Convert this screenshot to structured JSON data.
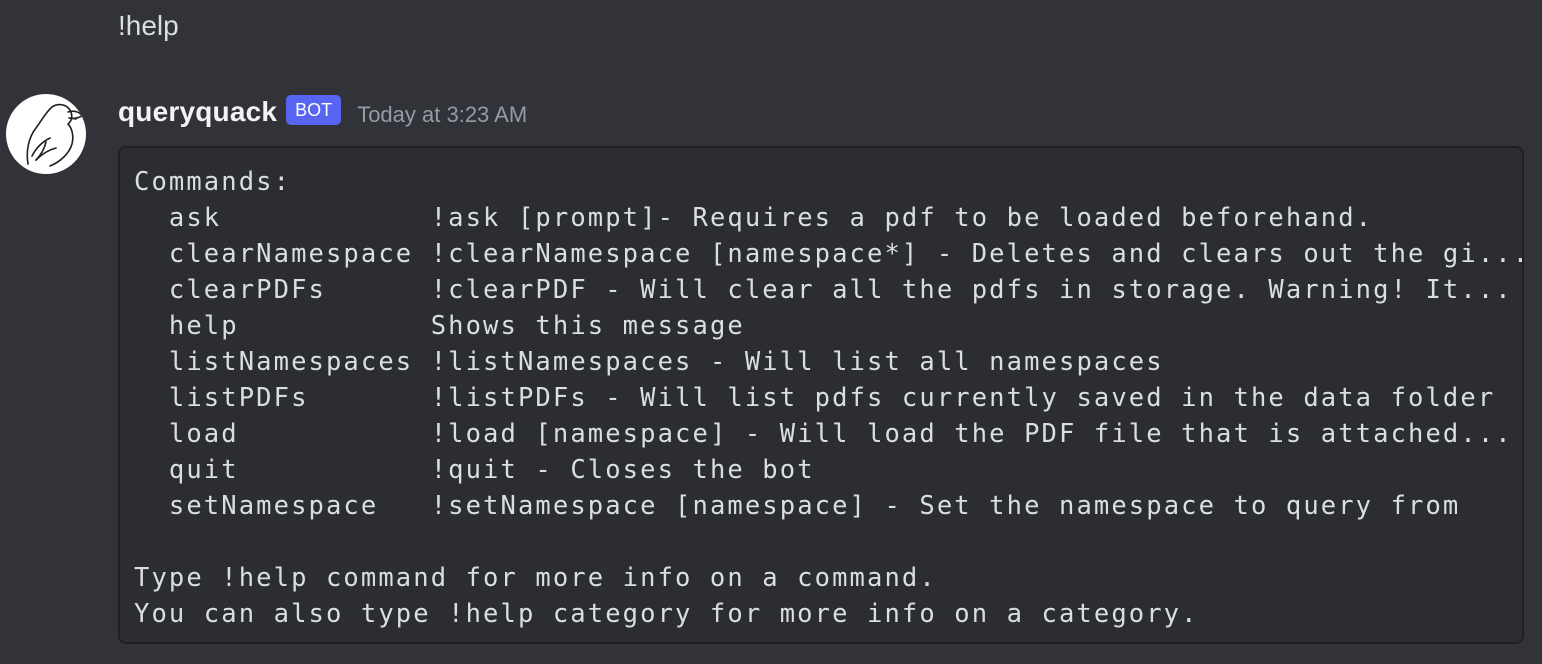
{
  "previous_message": {
    "text": "!help"
  },
  "message": {
    "username": "queryquack",
    "bot_tag": "BOT",
    "timestamp": "Today at 3:23 AM",
    "avatar": {
      "icon": "duck-line-art-icon",
      "background": "#ffffff"
    },
    "code": {
      "heading": "Commands:",
      "commands": [
        {
          "name": "ask",
          "description": "!ask [prompt]- Requires a pdf to be loaded beforehand."
        },
        {
          "name": "clearNamespace",
          "description": "!clearNamespace [namespace*] - Deletes and clears out the gi..."
        },
        {
          "name": "clearPDFs",
          "description": "!clearPDF - Will clear all the pdfs in storage. Warning! It..."
        },
        {
          "name": "help",
          "description": "Shows this message"
        },
        {
          "name": "listNamespaces",
          "description": "!listNamespaces - Will list all namespaces"
        },
        {
          "name": "listPDFs",
          "description": "!listPDFs - Will list pdfs currently saved in the data folder"
        },
        {
          "name": "load",
          "description": "!load [namespace] - Will load the PDF file that is attached..."
        },
        {
          "name": "quit",
          "description": "!quit - Closes the bot"
        },
        {
          "name": "setNamespace",
          "description": "!setNamespace [namespace] - Set the namespace to query from"
        }
      ],
      "footer_line_1": "Type !help command for more info on a command.",
      "footer_line_2": "You can also type !help category for more info on a category."
    }
  },
  "colors": {
    "background": "#313338",
    "codeblock_background": "#2b2d31",
    "bot_tag": "#5865f2",
    "timestamp": "#949ba4"
  }
}
